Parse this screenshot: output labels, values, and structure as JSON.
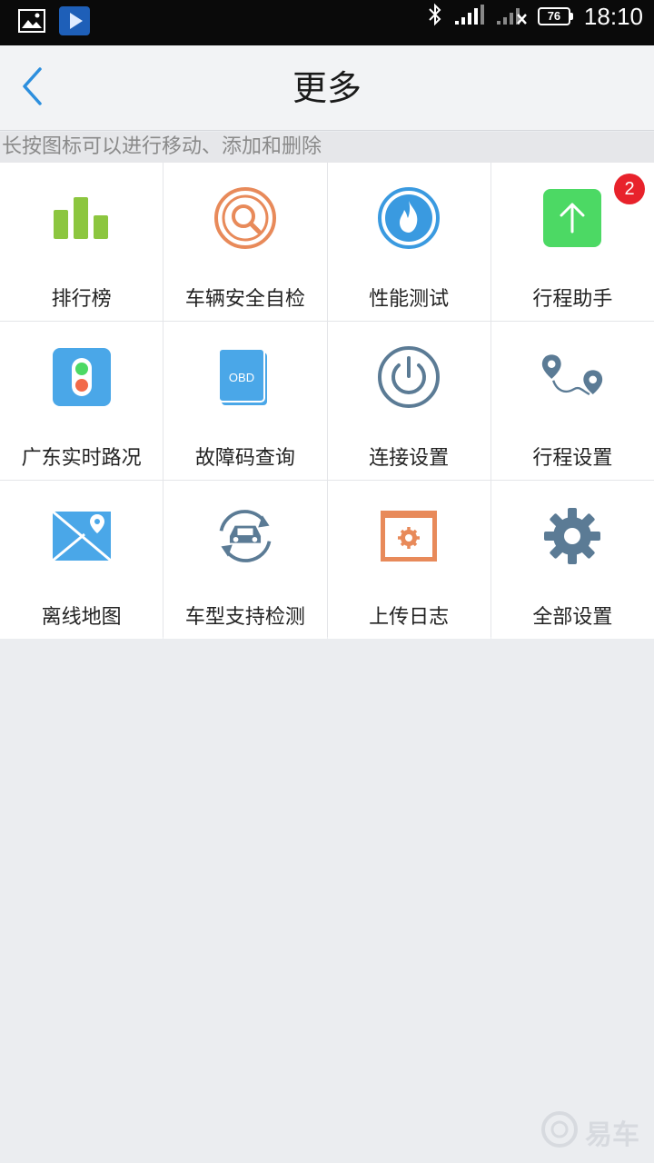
{
  "status_bar": {
    "time": "18:10",
    "battery": "76",
    "icons": [
      "gallery-icon",
      "media-play-icon",
      "bluetooth-icon",
      "signal-icon",
      "signal-x-icon",
      "battery-icon"
    ]
  },
  "nav": {
    "title": "更多",
    "back_icon": "chevron-left-icon"
  },
  "hint": "长按图标可以进行移动、添加和删除",
  "grid": {
    "items": [
      {
        "label": "排行榜",
        "icon": "ranking-bars-icon",
        "color": "#8cc63f"
      },
      {
        "label": "车辆安全自检",
        "icon": "inspection-search-icon",
        "color": "#e88a5a"
      },
      {
        "label": "性能测试",
        "icon": "flame-icon",
        "color": "#3a9ae0"
      },
      {
        "label": "行程助手",
        "icon": "arrow-up-icon",
        "color": "#4cd964",
        "badge": "2"
      },
      {
        "label": "广东实时路况",
        "icon": "traffic-light-icon",
        "color": "#4aa7e8"
      },
      {
        "label": "故障码查询",
        "icon": "obd-book-icon",
        "color": "#4aa7e8"
      },
      {
        "label": "连接设置",
        "icon": "power-icon",
        "color": "#5b7b95"
      },
      {
        "label": "行程设置",
        "icon": "route-pins-icon",
        "color": "#5b7b95"
      },
      {
        "label": "离线地图",
        "icon": "map-pin-icon",
        "color": "#4aa7e8"
      },
      {
        "label": "车型支持检测",
        "icon": "car-cycle-icon",
        "color": "#5b7b95"
      },
      {
        "label": "上传日志",
        "icon": "log-window-icon",
        "color": "#e88a5a"
      },
      {
        "label": "全部设置",
        "icon": "gear-icon",
        "color": "#5b7b95"
      }
    ]
  },
  "watermark": {
    "text": "易车",
    "icon": "bitauto-logo-icon"
  }
}
